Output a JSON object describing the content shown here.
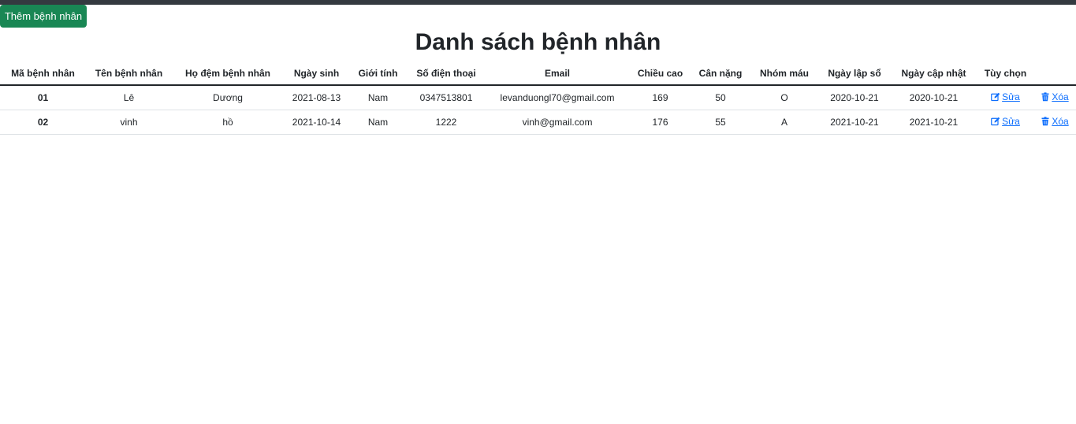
{
  "toolbar": {
    "add_label": "Thêm bệnh nhân"
  },
  "page": {
    "title": "Danh sách bệnh nhân"
  },
  "table": {
    "headers": [
      "Mã bệnh nhân",
      "Tên bệnh nhân",
      "Họ đệm bệnh nhân",
      "Ngày sinh",
      "Giới tính",
      "Số điện thoại",
      "Email",
      "Chiều cao",
      "Cân nặng",
      "Nhóm máu",
      "Ngày lập sổ",
      "Ngày cập nhật",
      "Tùy chọn",
      ""
    ],
    "rows": [
      {
        "id": "01",
        "first_name": "Lê",
        "last_name": "Dương",
        "dob": "2021-08-13",
        "gender": "Nam",
        "phone": "0347513801",
        "email": "levanduongl70@gmail.com",
        "height": "169",
        "weight": "50",
        "blood_type": "O",
        "created": "2020-10-21",
        "updated": "2020-10-21",
        "edit_label": "Sửa",
        "delete_label": "Xóa"
      },
      {
        "id": "02",
        "first_name": "vinh",
        "last_name": "hồ",
        "dob": "2021-10-14",
        "gender": "Nam",
        "phone": "1222",
        "email": "vinh@gmail.com",
        "height": "176",
        "weight": "55",
        "blood_type": "A",
        "created": "2021-10-21",
        "updated": "2021-10-21",
        "edit_label": "Sửa",
        "delete_label": "Xóa"
      }
    ]
  },
  "colors": {
    "topbar": "#343a40",
    "add_button": "#198754",
    "link": "#0d6efd"
  },
  "icons": {
    "edit": "edit-square-pen-icon",
    "delete": "trash-icon"
  }
}
